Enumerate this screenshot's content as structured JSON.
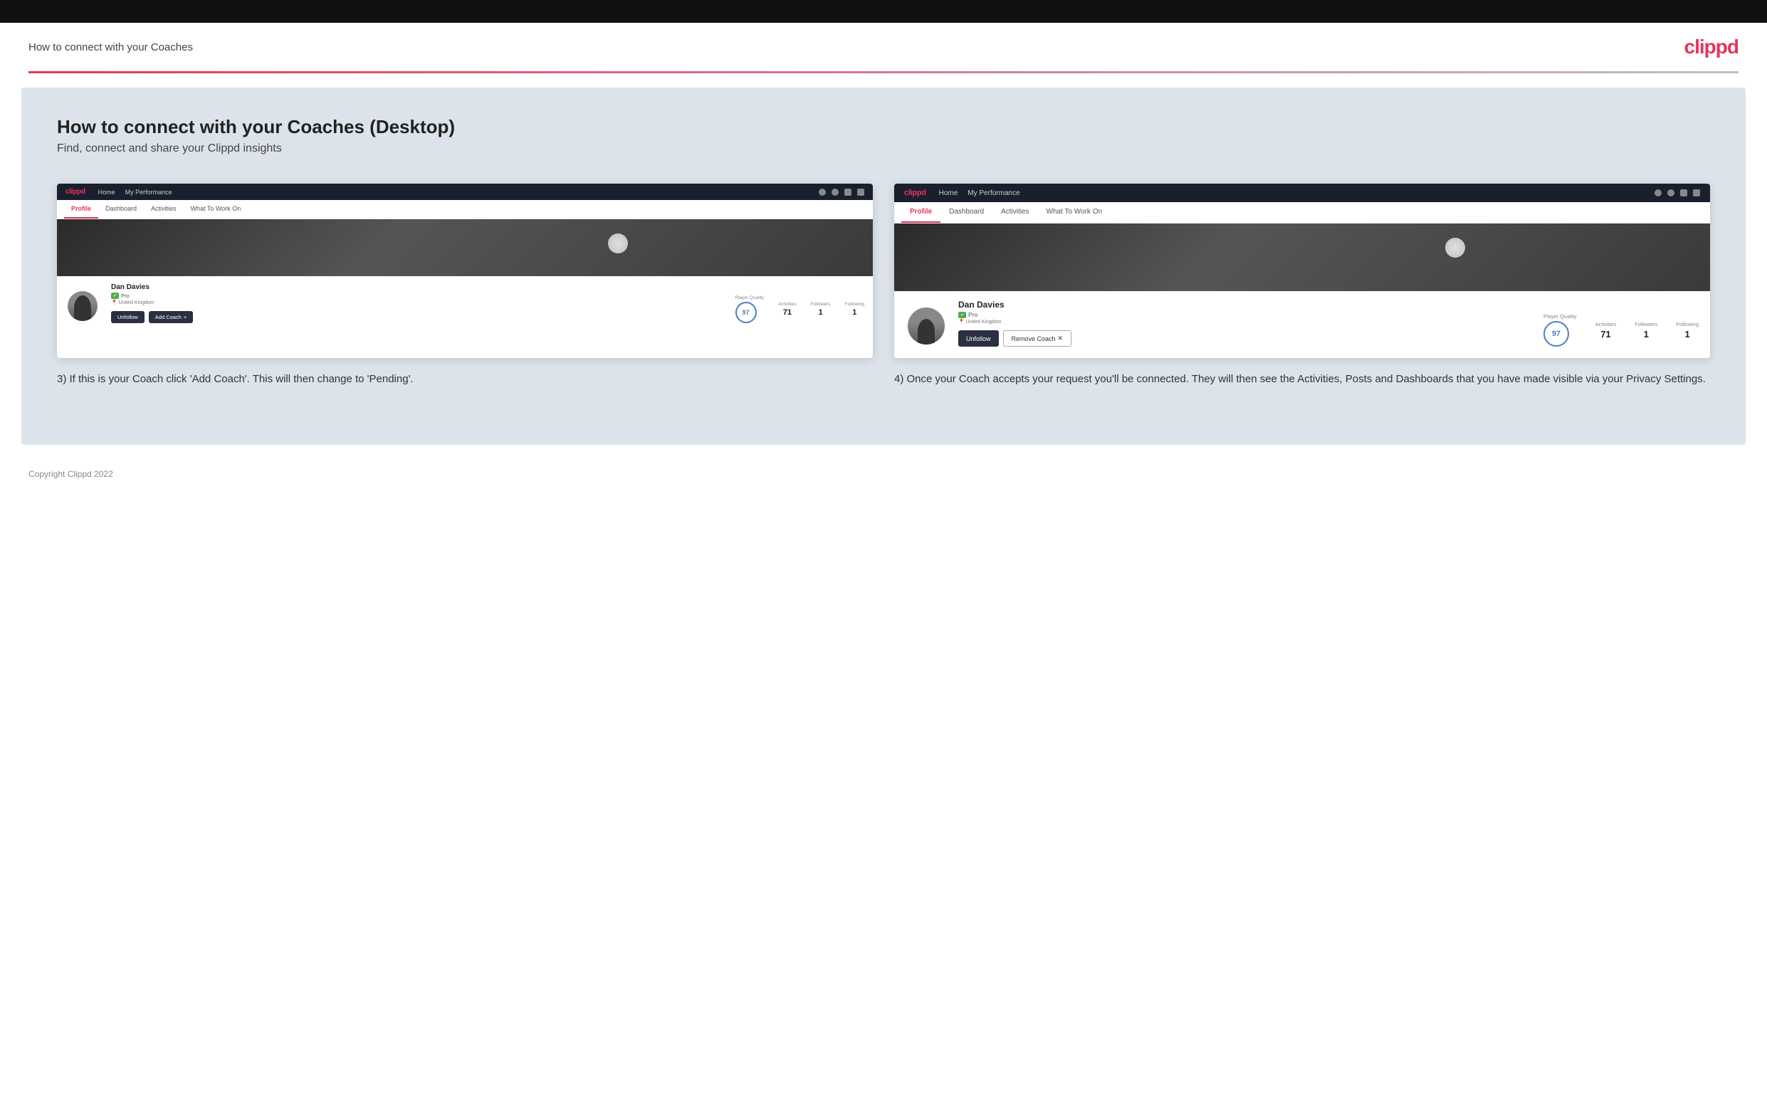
{
  "topbar": {},
  "header": {
    "title": "How to connect with your Coaches",
    "logo": "clippd"
  },
  "main": {
    "heading": "How to connect with your Coaches (Desktop)",
    "subheading": "Find, connect and share your Clippd insights",
    "screenshot_left": {
      "nav": {
        "logo": "clippd",
        "items": [
          "Home",
          "My Performance"
        ]
      },
      "tabs": [
        "Profile",
        "Dashboard",
        "Activities",
        "What To Work On"
      ],
      "active_tab": "Profile",
      "player": {
        "name": "Dan Davies",
        "pro": "Pro",
        "location": "United Kingdom",
        "player_quality_label": "Player Quality",
        "player_quality": "97",
        "activities_label": "Activities",
        "activities": "71",
        "followers_label": "Followers",
        "followers": "1",
        "following_label": "Following",
        "following": "1"
      },
      "buttons": {
        "unfollow": "Unfollow",
        "add_coach": "Add Coach"
      }
    },
    "screenshot_right": {
      "nav": {
        "logo": "clippd",
        "items": [
          "Home",
          "My Performance"
        ]
      },
      "tabs": [
        "Profile",
        "Dashboard",
        "Activities",
        "What To Work On"
      ],
      "active_tab": "Profile",
      "player": {
        "name": "Dan Davies",
        "pro": "Pro",
        "location": "United Kingdom",
        "player_quality_label": "Player Quality",
        "player_quality": "97",
        "activities_label": "Activities",
        "activities": "71",
        "followers_label": "Followers",
        "followers": "1",
        "following_label": "Following",
        "following": "1"
      },
      "buttons": {
        "unfollow": "Unfollow",
        "remove_coach": "Remove Coach"
      }
    },
    "caption_left": "3) If this is your Coach click 'Add Coach'. This will then change to 'Pending'.",
    "caption_right": "4) Once your Coach accepts your request you'll be connected. They will then see the Activities, Posts and Dashboards that you have made visible via your Privacy Settings."
  },
  "footer": {
    "copyright": "Copyright Clippd 2022"
  }
}
